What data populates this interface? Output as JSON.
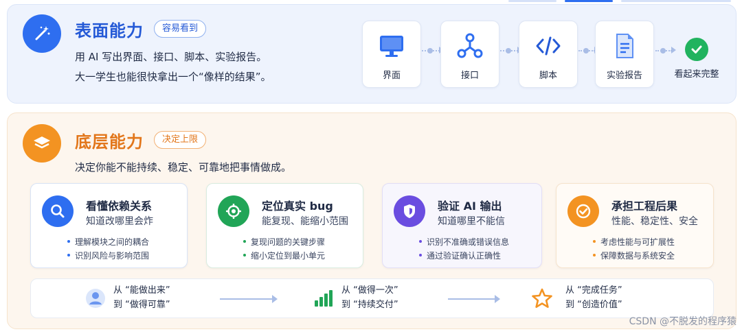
{
  "surface": {
    "title": "表面能力",
    "badge": "容易看到",
    "line1": "用 AI 写出界面、接口、脚本、实验报告。",
    "line2": "大一学生也能很快拿出一个“像样的结果”。",
    "flow": [
      "界面",
      "接口",
      "脚本",
      "实验报告",
      "看起来完整"
    ]
  },
  "base": {
    "title": "底层能力",
    "badge": "决定上限",
    "line1": "决定你能不能持续、稳定、可靠地把事情做成。",
    "cards": [
      {
        "title": "看懂依赖关系",
        "subtitle": "知道改哪里会炸",
        "bullets": [
          "理解模块之间的耦合",
          "识别风险与影响范围"
        ],
        "icon": "search-icon"
      },
      {
        "title": "定位真实 bug",
        "subtitle": "能复现、能缩小范围",
        "bullets": [
          "复现问题的关键步骤",
          "缩小定位到最小单元"
        ],
        "icon": "target-icon"
      },
      {
        "title": "验证 AI 输出",
        "subtitle": "知道哪里不能信",
        "bullets": [
          "识别不准确或错误信息",
          "通过验证确认正确性"
        ],
        "icon": "shield-icon"
      },
      {
        "title": "承担工程后果",
        "subtitle": "性能、稳定性、安全",
        "bullets": [
          "考虑性能与可扩展性",
          "保障数据与系统安全"
        ],
        "icon": "check-circle-icon"
      }
    ],
    "transitions": [
      {
        "from": "从  “能做出来”",
        "to": "到  “做得可靠”",
        "icon": "user-icon"
      },
      {
        "from": "从  “做得一次”",
        "to": "到  “持续交付”",
        "icon": "bar-chart-icon"
      },
      {
        "from": "从  “完成任务”",
        "to": "到  “创造价值”",
        "icon": "star-icon"
      }
    ]
  },
  "watermark": "CSDN @不脱发的程序猿",
  "colors": {
    "blue": "#2e6ef0",
    "orange": "#f39322",
    "green": "#21a557",
    "purple": "#6a4de0"
  }
}
